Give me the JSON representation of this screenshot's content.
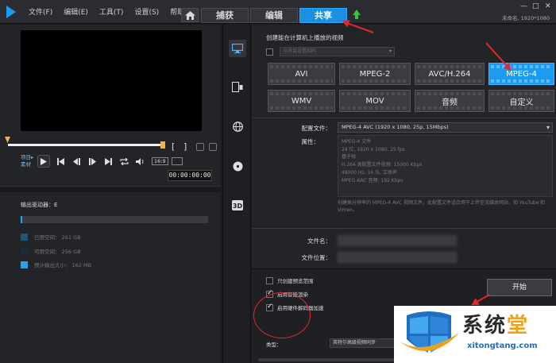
{
  "menu": [
    "文件(F)",
    "编辑(E)",
    "工具(T)",
    "设置(S)",
    "帮助(H)"
  ],
  "tabs": [
    {
      "label": "捕获",
      "active": false
    },
    {
      "label": "编辑",
      "active": false
    },
    {
      "label": "共享",
      "active": true
    }
  ],
  "window_controls": {
    "minimize": "—",
    "maximize": "□",
    "close": "✕"
  },
  "project_info": "未命名, 1920*1080",
  "player": {
    "mode_label": "项目▸",
    "mode_label2": "素材",
    "timecode": "00:00:00:00",
    "aspect": "16:9",
    "controls": [
      "play-icon",
      "start-icon",
      "prev-frame-icon",
      "next-frame-icon",
      "end-icon",
      "repeat-icon",
      "volume-icon"
    ]
  },
  "output": {
    "label": "输出驱动器：E",
    "usage_fraction": 0.01,
    "legend": [
      {
        "label": "已用空间： 261 GB",
        "color": "#23536f"
      },
      {
        "label": "可用空间： 256 GB",
        "color": "#1b2a38"
      },
      {
        "label": "预计输出大小： 162 MB",
        "color": "#2aa0f0"
      }
    ]
  },
  "side_icons": [
    "computer-icon",
    "device-icon",
    "web-icon",
    "disc-icon",
    "3d-icon"
  ],
  "share": {
    "create_title": "创建能在计算机上播放的视频",
    "same_as_project_label": "与项目设置相同",
    "formats": [
      {
        "label": "AVI",
        "active": false
      },
      {
        "label": "MPEG-2",
        "active": false
      },
      {
        "label": "AVC/H.264",
        "active": false
      },
      {
        "label": "MPEG-4",
        "active": true
      },
      {
        "label": "WMV",
        "active": false
      },
      {
        "label": "MOV",
        "active": false
      },
      {
        "label": "音频",
        "active": false
      },
      {
        "label": "自定义",
        "active": false
      }
    ],
    "profile_label": "配置文件：",
    "profile_value": "MPEG-4 AVC (1920 x 1080, 25p, 15Mbps)",
    "properties_label": "属性：",
    "properties": [
      "MPEG-4 文件",
      "24 位, 1920 x 1080, 25 fps",
      "基于帧",
      "H.264 高配置文件视频: 15000 Kbps",
      "48000 Hz, 16 位, 立体声",
      "MPEG AAC 音频: 192 Kbps"
    ],
    "description": "创建高分辨率的 MPEG-4 AVC 视频文件。此配置文件适合用于上传至流媒体网站，如 YouTube 和 Vimeo。",
    "filename_label": "文件名：",
    "location_label": "文件位置：",
    "options": [
      {
        "label": "只创建预览范围",
        "checked": false
      },
      {
        "label": "启用智能渲染",
        "checked": true
      },
      {
        "label": "启用硬件解码器加速",
        "checked": true
      }
    ],
    "type_label": "类型：",
    "type_value": "英特尔高级视频同步",
    "start_label": "开始"
  },
  "watermark": {
    "title_main": "系统",
    "title_accent": "堂",
    "url": "xitongtang.com"
  }
}
